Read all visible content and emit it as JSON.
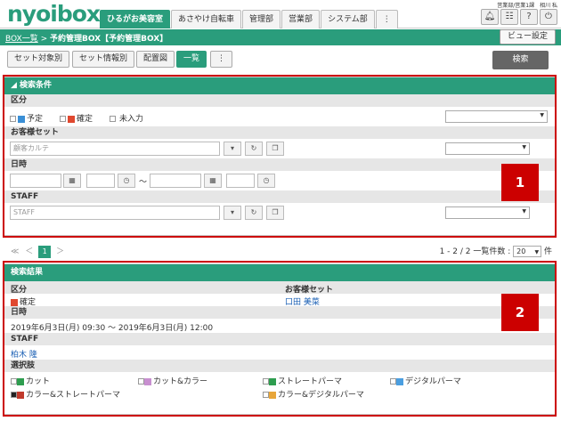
{
  "header": {
    "logo": "nyoibox",
    "user_info": "営業部/営業1課　相川 私",
    "tabs": [
      {
        "label": "ひるがお美容室",
        "active": true
      },
      {
        "label": "あさやけ自転車",
        "active": false
      },
      {
        "label": "管理部",
        "active": false
      },
      {
        "label": "営業部",
        "active": false
      },
      {
        "label": "システム部",
        "active": false
      },
      {
        "label": "⋮",
        "active": false
      }
    ],
    "icons": [
      "bell-icon",
      "org-icon",
      "help-icon",
      "power-icon"
    ]
  },
  "breadcrumb": {
    "root": "BOX一覧",
    "sep": " > ",
    "current": "予約管理BOX【予約管理BOX】"
  },
  "view_settings_label": "ビュー設定",
  "toolbar": {
    "buttons": [
      {
        "label": "セット対象別",
        "active": false
      },
      {
        "label": "セット情報別",
        "active": false
      },
      {
        "label": "配置図",
        "active": false
      },
      {
        "label": "一覧",
        "active": true
      },
      {
        "label": "⋮",
        "active": false
      }
    ],
    "search_label": "検索"
  },
  "search_panel": {
    "title": "◢ 検索条件",
    "kubun_label": "区分",
    "kubun_options": [
      {
        "label": "予定",
        "color": "#3a8fd6"
      },
      {
        "label": "確定",
        "color": "#e0482f"
      },
      {
        "label": "未入力",
        "color": ""
      }
    ],
    "customer_label": "お客様セット",
    "customer_placeholder": "顧客カルテ",
    "datetime_label": "日時",
    "tilde": "〜",
    "staff_label": "STAFF",
    "staff_placeholder": "STAFF"
  },
  "pager": {
    "first": "≪",
    "prev": "＜",
    "current": "1",
    "next": "＞",
    "summary": "1 - 2 / 2 一覧件数 :",
    "per_page": "20",
    "unit": "件"
  },
  "result_panel": {
    "title": "検索結果",
    "kubun_label": "区分",
    "kubun_value": "確定",
    "kubun_color": "#e0482f",
    "customer_label": "お客様セット",
    "customer_value": "口田 美菜",
    "datetime_label": "日時",
    "datetime_value": "2019年6月3日(月) 09:30 〜 2019年6月3日(月) 12:00",
    "staff_label": "STAFF",
    "staff_value": "柏木 隆",
    "choices_label": "選択肢",
    "choices": [
      {
        "label": "カット",
        "color": "#2e9d4f"
      },
      {
        "label": "カット&カラー",
        "color": "#c88fd0"
      },
      {
        "label": "ストレートパーマ",
        "color": "#2e9d4f"
      },
      {
        "label": "デジタルパーマ",
        "color": "#4a9ee0"
      },
      {
        "label": "カラー&ストレートパーマ",
        "color": "#c0392b"
      },
      {
        "label": "カラー&デジタルパーマ",
        "color": "#e8a63a"
      }
    ]
  },
  "markers": [
    "1",
    "2"
  ]
}
